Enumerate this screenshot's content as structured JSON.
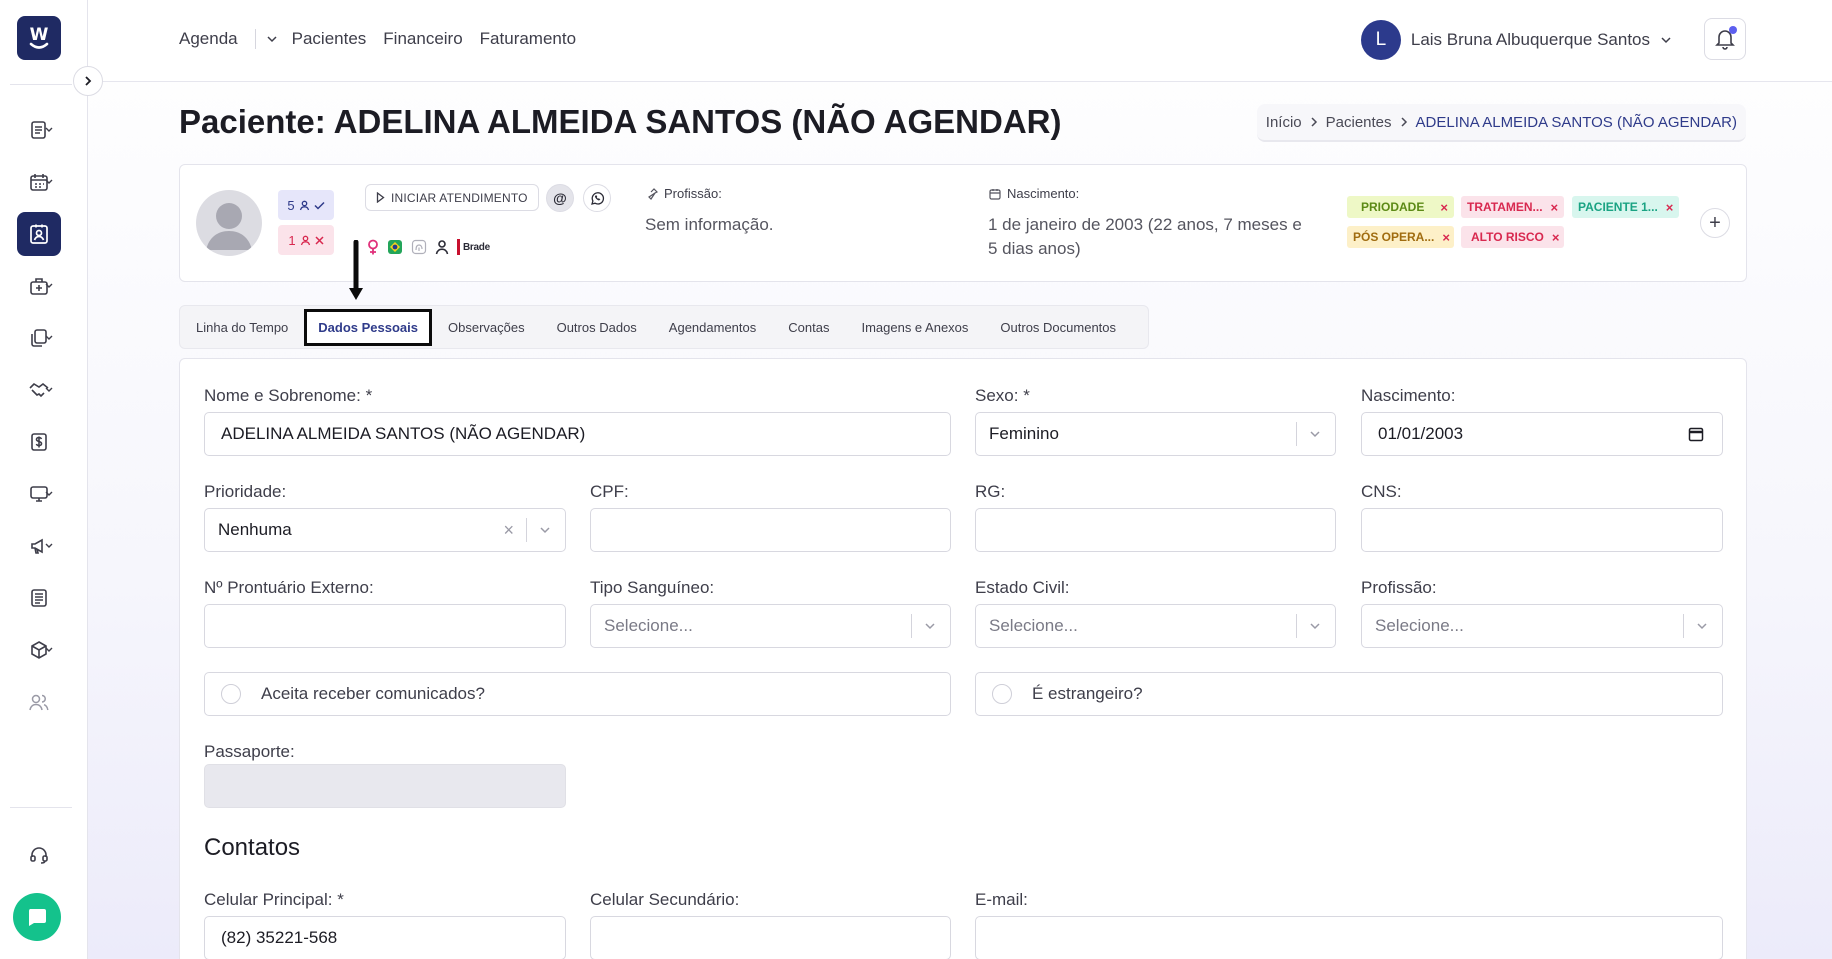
{
  "sidebar": {
    "logo_letter": "W",
    "items": [
      {
        "icon": "list-icon",
        "active": false
      },
      {
        "icon": "calendar-icon",
        "active": false
      },
      {
        "icon": "patient-id-icon",
        "active": true
      },
      {
        "icon": "medical-bag-icon",
        "active": false
      },
      {
        "icon": "documents-icon",
        "active": false
      },
      {
        "icon": "handshake-icon",
        "active": false
      },
      {
        "icon": "dollar-icon",
        "active": false
      },
      {
        "icon": "monitor-icon",
        "active": false
      },
      {
        "icon": "megaphone-icon",
        "active": false
      },
      {
        "icon": "report-icon",
        "active": false
      },
      {
        "icon": "box-icon",
        "active": false
      },
      {
        "icon": "users-icon",
        "active": false
      }
    ]
  },
  "topnav": {
    "agenda": "Agenda",
    "pacientes": "Pacientes",
    "financeiro": "Financeiro",
    "faturamento": "Faturamento"
  },
  "user": {
    "initial": "L",
    "name": "Lais Bruna Albuquerque Santos"
  },
  "page": {
    "title": "Paciente: ADELINA ALMEIDA SANTOS (NÃO AGENDAR)"
  },
  "breadcrumb": {
    "home": "Início",
    "section": "Pacientes",
    "current": "ADELINA ALMEIDA SANTOS (NÃO AGENDAR)"
  },
  "patient_card": {
    "attended_count": "5",
    "missed_count": "1",
    "start_button": "INICIAR ATENDIMENTO",
    "at_symbol": "@",
    "insurance_text": "Brade",
    "profession_label": "Profissão:",
    "profession_value": "Sem informação.",
    "birth_label": "Nascimento:",
    "birth_value_line1": "1 de janeiro de 2003 (22 anos, 7 meses e",
    "birth_value_line2": "5 dias anos)",
    "tags": [
      {
        "label": "PRIODADE",
        "bg": "#eef8c6",
        "fg": "#5c8a16"
      },
      {
        "label": "TRATAMEN...",
        "bg": "#fbe3ea",
        "fg": "#d8284f"
      },
      {
        "label": "PACIENTE 1...",
        "bg": "#d8f6ee",
        "fg": "#1aa383"
      },
      {
        "label": "PÓS OPERA...",
        "bg": "#fdf0c8",
        "fg": "#a06c10"
      },
      {
        "label": "ALTO RISCO",
        "bg": "#fbe3ea",
        "fg": "#d8284f"
      }
    ],
    "tag_remove": "×",
    "add_tag": "+"
  },
  "tabs": [
    "Linha do Tempo",
    "Dados Pessoais",
    "Observações",
    "Outros Dados",
    "Agendamentos",
    "Contas",
    "Imagens e Anexos",
    "Outros Documentos"
  ],
  "form": {
    "nome_label": "Nome e Sobrenome: *",
    "nome_value": "ADELINA ALMEIDA SANTOS (NÃO AGENDAR)",
    "sexo_label": "Sexo: *",
    "sexo_value": "Feminino",
    "nascimento_label": "Nascimento:",
    "nascimento_value": "01/01/2003",
    "prioridade_label": "Prioridade:",
    "prioridade_value": "Nenhuma",
    "cpf_label": "CPF:",
    "rg_label": "RG:",
    "cns_label": "CNS:",
    "prontuario_label": "Nº Prontuário Externo:",
    "sangue_label": "Tipo Sanguíneo:",
    "estado_civil_label": "Estado Civil:",
    "profissao_label": "Profissão:",
    "select_placeholder": "Selecione...",
    "comunicados_label": "Aceita receber comunicados?",
    "estrangeiro_label": "É estrangeiro?",
    "passaporte_label": "Passaporte:",
    "contatos_title": "Contatos",
    "celular_label": "Celular Principal: *",
    "celular_value": "(82) 35221-568",
    "celular2_label": "Celular Secundário:",
    "email_label": "E-mail:"
  }
}
